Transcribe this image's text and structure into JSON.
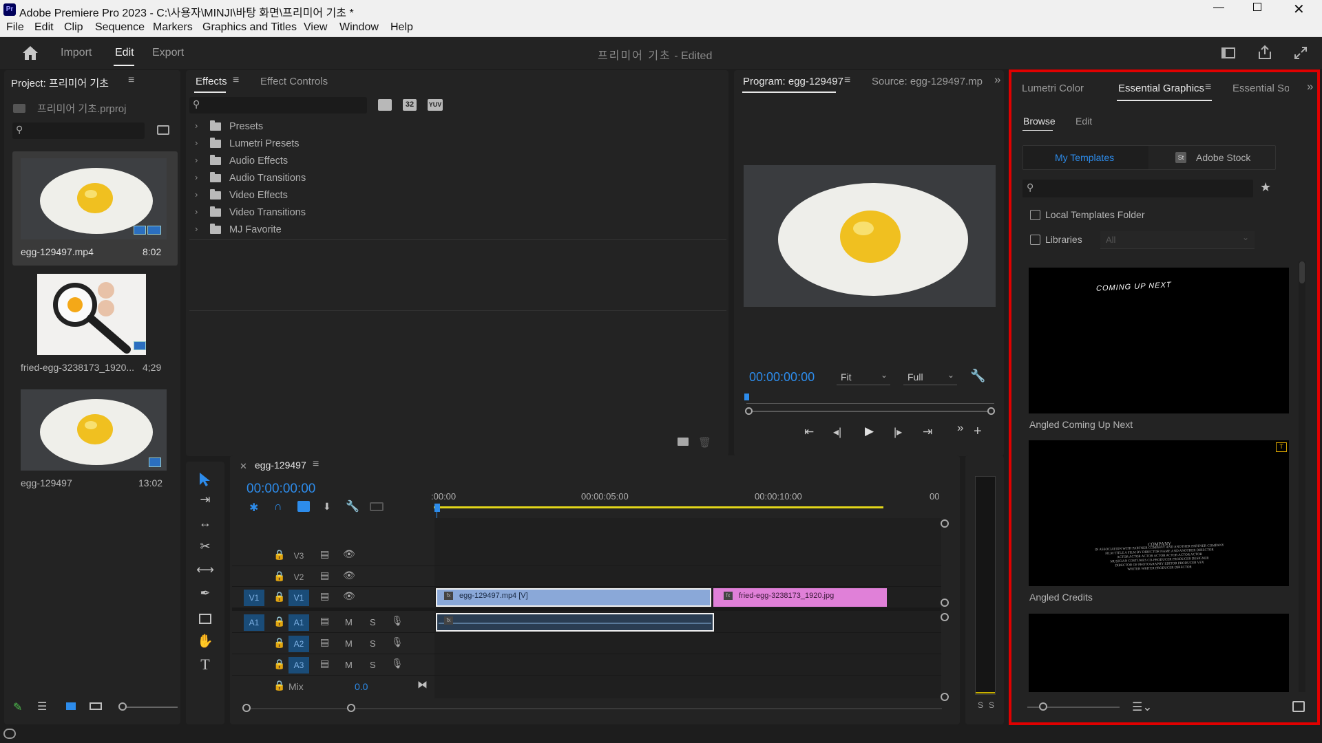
{
  "window": {
    "title": "Adobe Premiere Pro 2023 - C:\\사용자\\MINJI\\바탕 화면\\프리미어 기초 *",
    "app_icon": "Pr"
  },
  "menu": [
    "File",
    "Edit",
    "Clip",
    "Sequence",
    "Markers",
    "Graphics and Titles",
    "View",
    "Window",
    "Help"
  ],
  "workspace": {
    "tabs": [
      "Import",
      "Edit",
      "Export"
    ],
    "active": "Edit",
    "project_title": "프리미어 기초",
    "edited_suffix": " - Edited"
  },
  "project": {
    "title": "Project: 프리미어 기초",
    "file": "프리미어 기초.prproj",
    "items": [
      {
        "name": "egg-129497.mp4",
        "duration": "8:02"
      },
      {
        "name": "fried-egg-3238173_1920...",
        "duration": "4;29"
      },
      {
        "name": "egg-129497",
        "duration": "13:02"
      }
    ]
  },
  "effects": {
    "tabs": [
      "Effects",
      "Effect Controls"
    ],
    "toolbar_buttons": [
      "32",
      "YUV"
    ],
    "folders": [
      "Presets",
      "Lumetri Presets",
      "Audio Effects",
      "Audio Transitions",
      "Video Effects",
      "Video Transitions",
      "MJ Favorite"
    ]
  },
  "program": {
    "tab": "Program: egg-129497",
    "source_tab": "Source: egg-129497.mp",
    "timecode": "00:00:00:00",
    "fit": "Fit",
    "quality": "Full"
  },
  "timeline": {
    "sequence": "egg-129497",
    "timecode": "00:00:00:00",
    "ruler": [
      ":00:00",
      "00:00:05:00",
      "00:00:10:00",
      "00"
    ],
    "video_tracks": [
      "V3",
      "V2",
      "V1"
    ],
    "audio_tracks": [
      "A1",
      "A2",
      "A3"
    ],
    "source_v": "V1",
    "source_a": "A1",
    "mute": "M",
    "solo": "S",
    "mix_label": "Mix",
    "mix_value": "0.0",
    "clips": [
      {
        "name": "egg-129497.mp4 [V]",
        "color": "#8aa8d8"
      },
      {
        "name": "fried-egg-3238173_1920.jpg",
        "color": "#e080d8"
      }
    ]
  },
  "meter": {
    "labels": [
      "S",
      "S"
    ]
  },
  "essential_graphics": {
    "tabs": [
      "Lumetri Color",
      "Essential Graphics",
      "Essential Sou"
    ],
    "subtabs": [
      "Browse",
      "Edit"
    ],
    "sources": [
      "My Templates",
      "Adobe Stock"
    ],
    "stock_badge": "St",
    "options": [
      "Local Templates Folder",
      "Libraries"
    ],
    "libraries_value": "All",
    "templates": [
      {
        "name": "Angled Coming Up Next",
        "overlay_text": "COMING UP NEXT"
      },
      {
        "name": "Angled Credits"
      }
    ],
    "credits_lines": [
      "COMPANY",
      "IN ASSOCIATION WITH PARTNER COMPANY AND ANOTHER PARTNER COMPANY",
      "FILM TITLE A FILM BY DIRECTOR NAME AND ANOTHER DIRECTOR",
      "ACTOR ACTOR ACTOR ACTOR ACTOR ACTOR ACTOR",
      "MUSICIAN COSTUMES CO-PRODUCER PRODUCER DESIGNER",
      "DIRECTOR OF PHOTOGRAPHY EDITOR PRODUCER VFX",
      "WRITER WRITER PRODUCER DIRECTOR"
    ]
  },
  "colors": {
    "accent": "#2d8ceb",
    "highlight": "#e00000",
    "playhead": "#2d8ceb"
  }
}
